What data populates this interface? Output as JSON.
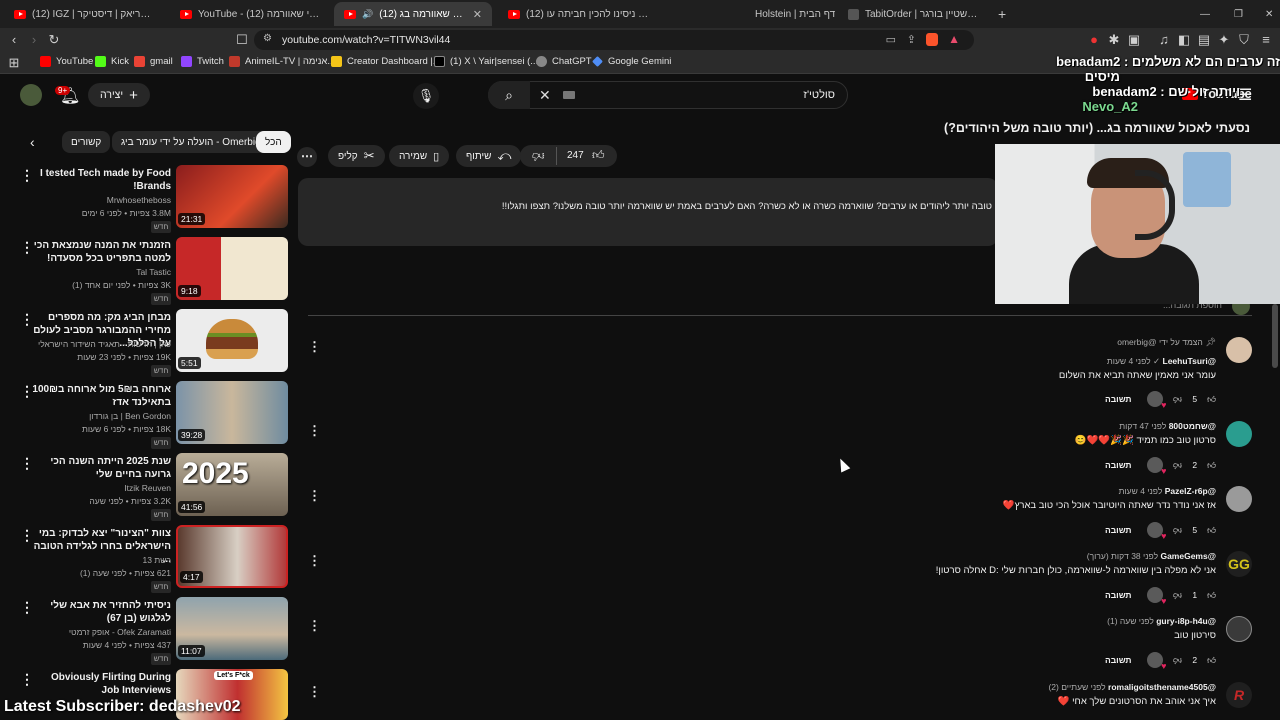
{
  "browser": {
    "tabs": [
      {
        "label": "(12) IGZ | דיסטריאק | דיסטיקר - YouTube"
      },
      {
        "label": "YouTube - רונן גיני שאוורמה (12)"
      },
      {
        "label": "(12) נסעתי לאכול שאוורמה בג..."
      },
      {
        "label": "(12) מאותגרים | ניסינו להכין חביתה עו..."
      },
      {
        "label": "Holstein | דף הבית"
      },
      {
        "label": "TabitOrder | סוף עצמי הולשטיין בורגר"
      }
    ],
    "url": "youtube.com/watch?v=TITWN3vil44",
    "bookmarks": [
      {
        "label": "YouTube",
        "color": "#ff0000"
      },
      {
        "label": "Kick",
        "color": "#53fc18"
      },
      {
        "label": "gmail",
        "color": "#ea4335"
      },
      {
        "label": "Twitch",
        "color": "#9146ff"
      },
      {
        "label": "AnimeIL-TV | אנימה...",
        "color": "#c0392b"
      },
      {
        "label": "Creator Dashboard |...",
        "color": "#f5c518"
      },
      {
        "label": "(1) X \\ Yair|sensei (...",
        "color": "#000000"
      },
      {
        "label": "ChatGPT",
        "color": "#888888"
      },
      {
        "label": "Google Gemini",
        "color": "#4f8df5"
      }
    ]
  },
  "youtube": {
    "create_label": "יצירה",
    "notif_count": "9+",
    "search_value": "סולטי'ז",
    "logo": "YouTube",
    "video_title": "נסעתי לאכול שאוורמה בג... (יותר טובה משל היהודים?)",
    "likes": "247",
    "share_label": "שיתוף",
    "save_label": "שמירה",
    "clip_label": "קליפ",
    "description": "טובה יותר ליהודים או ערבים? שווארמה כשרה או לא כשרה? האם לערבים באמת יש שווארמה יותר טובה משלנו? תצפו ותגלו!!",
    "add_comment": "הוספת תגובה...",
    "chips": [
      {
        "label": "הכל"
      },
      {
        "label": "הועלה על ידי עומר ביג - Omerbig"
      },
      {
        "label": "קשורים"
      }
    ]
  },
  "sidebar_videos": [
    {
      "title": "I tested Tech made by Food Brands!",
      "channel": "Mrwhosetheboss",
      "meta": "3.8M צפיות • לפני 6 ימים",
      "duration": "21:31",
      "tag": "חדש",
      "thumb_color": "#c0392b"
    },
    {
      "title": "הזמנתי את המנה שנמצאת הכי למטה בתפריט בכל מסעדה!",
      "channel": "Tal Tastic",
      "meta": "3K צפיות • לפני יום אחד (1)",
      "duration": "9:18",
      "tag": "חדש",
      "thumb_color": "#2e7d32"
    },
    {
      "title": "מבחן הביג מק: מה מספרים מחירי ההמבורגר מסביב לעולם על הכלכל...",
      "channel": "כאן | חדשות - תאגיד השידור הישראלי",
      "meta": "19K צפיות • לפני 23 שעות",
      "duration": "5:51",
      "tag": "חדש",
      "thumb_color": "#e8e8e8"
    },
    {
      "title": "ארוחה ב5₪ מול ארוחה ב100₪ בתאילנד אדז",
      "channel": "Ben Gordon | בן גורדון",
      "meta": "18K צפיות • לפני 6 שעות",
      "duration": "39:28",
      "tag": "חדש",
      "thumb_color": "#6d8fa8"
    },
    {
      "title": "שנת 2025 הייתה השנה הכי גרועה בחיים שלי",
      "channel": "Itzik Reuven",
      "meta": "3.2K צפיות • לפני שעה",
      "duration": "41:56",
      "tag": "חדש",
      "thumb_color": "#8a7d6b"
    },
    {
      "title": "צוות \"הצינור\" יצא לבדוק: במי הישראלים בחרו לגלידה הטובה ...",
      "channel": "רשת 13",
      "meta": "621 צפיות • לפני שעה (1)",
      "duration": "4:17",
      "tag": "חדש",
      "thumb_color": "#b33a3a"
    },
    {
      "title": "ניסיתי להחזיר את אבא שלי לגלגוש (בן 67)",
      "channel": "Ofek Zaramati - אופק זרמטי",
      "meta": "437 צפיות • לפני 4 שעות",
      "duration": "11:07",
      "tag": "חדש",
      "thumb_color": "#7a8c99"
    },
    {
      "title": "Obviously Flirting During Job Interviews",
      "channel": "",
      "meta": "",
      "duration": "",
      "tag": "",
      "thumb_color": "#d9c4a0"
    }
  ],
  "comments": [
    {
      "pinned": "הצמד על ידי @omerbig",
      "author": "@LeehuTsuri",
      "time": "לפני 4 שעות",
      "text": "עומר אני מאמין שאתה תביא את השלום",
      "likes": "5",
      "reply": "תשובה",
      "avatar_color": "#d8c0a8"
    },
    {
      "pinned": "",
      "author": "@שחמט800",
      "time": "לפני 47 דקות",
      "text": "סרטון טוב כמו תמיד 🎉🎉❤️❤️😊",
      "likes": "2",
      "reply": "תשובה",
      "avatar_color": "#2a9d8f"
    },
    {
      "pinned": "",
      "author": "@PazelZ-r6p",
      "time": "לפני 4 שעות",
      "text": "אז אני נודר נדר שאתה היוטיובר אוכל הכי טוב בארץ❤️",
      "likes": "5",
      "reply": "תשובה",
      "avatar_color": "#9a9a9a"
    },
    {
      "pinned": "",
      "author": "@GameGems",
      "time": "לפני 38 דקות (ערוך)",
      "text": "אני לא מפלה בין שווארמה ל-שווארמה, כולן חברות שלי :D אחלה סרטון!",
      "likes": "1",
      "reply": "תשובה",
      "avatar_color": "#1f1f1f"
    },
    {
      "pinned": "",
      "author": "@gury-i8p-h4u",
      "time": "לפני שעה (1)",
      "text": "סירטון טוב",
      "likes": "2",
      "reply": "תשובה",
      "avatar_color": "#3a3a3a"
    },
    {
      "pinned": "",
      "author": "@romaligoitsthename4505",
      "time": "לפני שעתיים (2)",
      "text": "איך אני אוהב את הסרטונים שלך אחי ❤️",
      "likes": "",
      "reply": "",
      "avatar_color": "#1f1f1f"
    }
  ],
  "overlay": {
    "chat_line1": "זה ערבים הם לא משלמים : benadam2",
    "chat_line2": "מיסים",
    "chat_line3": "ויותר זול שם : benadam2",
    "chat_line4": "Nevo_A2",
    "subscriber": "Latest Subscriber: dedashev02"
  }
}
